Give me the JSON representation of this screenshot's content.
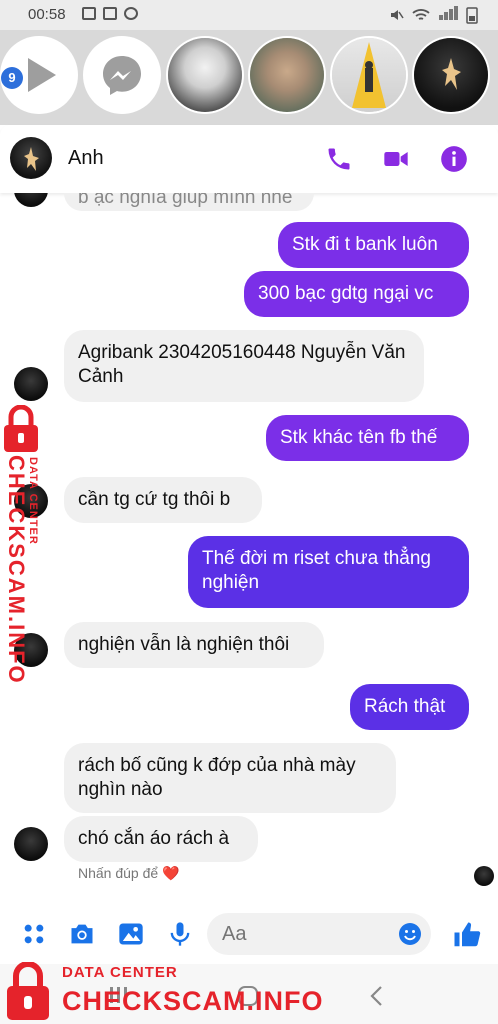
{
  "status_bar": {
    "time": "00:58"
  },
  "chat_heads": {
    "badge_count": "9"
  },
  "header": {
    "contact_name": "Anh"
  },
  "messages": [
    {
      "side": "in",
      "text": "b ạc nghĩa giúp mình nhé"
    },
    {
      "side": "out",
      "text": "Stk đi t bank luôn"
    },
    {
      "side": "out",
      "text": "300 bạc gdtg ngại vc"
    },
    {
      "side": "in",
      "text": "Agribank 2304205160448 Nguyễn Văn Cảnh"
    },
    {
      "side": "out",
      "text": "Stk khác tên fb thế"
    },
    {
      "side": "in",
      "text": "cần tg cứ tg thôi b"
    },
    {
      "side": "out",
      "text": "Thế đời m riset chưa thẳng nghiện"
    },
    {
      "side": "in",
      "text": "nghiện vẫn là nghiện thôi"
    },
    {
      "side": "out",
      "text": "Rách thật"
    },
    {
      "side": "in",
      "text": "rách bố cũng k đớp của nhà mày nghìn nào"
    },
    {
      "side": "in",
      "text": "chó cắn áo rách à"
    }
  ],
  "reaction_hint": {
    "text": "Nhấn đúp để",
    "emoji": "❤️"
  },
  "composer": {
    "placeholder": "Aa"
  },
  "watermark": {
    "vertical_top": "DATA CENTER",
    "vertical_main": "CHECKSCAM.INFO",
    "bottom_top": "DATA CENTER",
    "bottom_main": "CHECKSCAM.INFO"
  },
  "colors": {
    "accent": "#7b2fe8",
    "messenger_blue": "#1a73e8",
    "watermark_red": "#e5232b"
  }
}
